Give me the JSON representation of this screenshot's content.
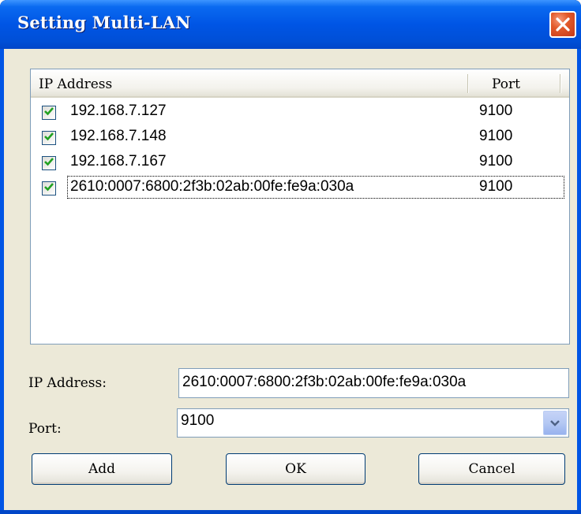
{
  "window": {
    "title": "Setting Multi-LAN"
  },
  "list": {
    "columns": {
      "ip": "IP Address",
      "port": "Port"
    },
    "rows": [
      {
        "checked": true,
        "ip": "192.168.7.127",
        "port": "9100"
      },
      {
        "checked": true,
        "ip": "192.168.7.148",
        "port": "9100"
      },
      {
        "checked": true,
        "ip": "192.168.7.167",
        "port": "9100"
      },
      {
        "checked": true,
        "ip": "2610:0007:6800:2f3b:02ab:00fe:fe9a:030a",
        "port": "9100"
      }
    ]
  },
  "form": {
    "ip_label": "IP Address:",
    "ip_value": "2610:0007:6800:2f3b:02ab:00fe:fe9a:030a",
    "port_label": "Port:",
    "port_value": "9100"
  },
  "buttons": {
    "add": "Add",
    "ok": "OK",
    "cancel": "Cancel"
  },
  "icons": {
    "close": "close-icon",
    "check": "checkmark-icon",
    "dropdown": "chevron-down-icon"
  },
  "colors": {
    "title_bar": "#0055e5",
    "dialog_face": "#ece9d8",
    "close_button": "#e25a2a",
    "check_green": "#21a121"
  }
}
